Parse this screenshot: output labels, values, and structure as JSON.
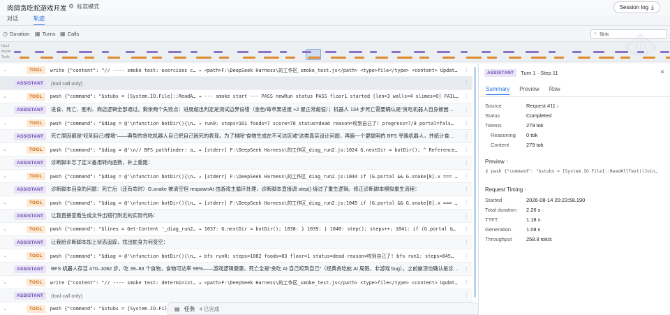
{
  "header": {
    "app_title": "肉鸽贪吃蛇游戏开发",
    "mode_label": "标准模式",
    "session_log_label": "Session log"
  },
  "tabs": [
    {
      "label": "对话",
      "active": false
    },
    {
      "label": "轨迹",
      "active": true
    }
  ],
  "toolbar": {
    "duration_label": "Duration",
    "turns_label": "Turns",
    "calls_label": "Calls",
    "search_placeholder": "搜索"
  },
  "timeline": {
    "row_labels": [
      "Input",
      "Model",
      "Tools"
    ]
  },
  "log_rows": [
    {
      "kind": "tool",
      "badge": "TOOL",
      "text": "write {\"content\": \"// ---- smoke test: exercises c… → <path>F:\\DeepSeek Harness\\的工作区_smoke_test.js</path> <type>file</type> <content> Update…"
    },
    {
      "kind": "assistant",
      "badge": "ASSISTANT",
      "text": "(tool call only)",
      "selected": true
    },
    {
      "kind": "tool",
      "badge": "TOOL",
      "text": "pwsh {\"command\": \"$stubs = [System.IO.File]::ReadA… → --- smoke start --- PASS newRun status PASS floor1 started [len=3 walls=4 slimes=0] FAIL…"
    },
    {
      "kind": "assistant",
      "badge": "ASSISTANT",
      "text": "进食、死亡、胜利、商店逻辑全部通过。剩余两个失败点：进度超出判定是测试边界设错（金色/毒苹果进度 +2 屋正常超值）；机器人 134 步死亡需要确认是\"贪吃机器人自身被困…"
    },
    {
      "kind": "tool",
      "badge": "TOOL",
      "text": "pwsh {\"command\": \"$diag = @'\\nfunction botDir(){\\n… → run0: steps=101 foods=7 score=70 status=dead reason=咬到自己了! progress=7/8 portal=fals…"
    },
    {
      "kind": "assistant",
      "badge": "ASSISTANT",
      "text": "死亡原因都是\"咬到自己/撞墙\"——典型的贪吃机器人自己把自己困死的表现。为了排除\"食物生成在不可达区域\"这类真实设计问题，再跑一个更聪明的 BFS 寻路机器人，并统计食…"
    },
    {
      "kind": "tool",
      "badge": "TOOL",
      "text": "pwsh {\"command\": \"$diag = @'\\n// BFS pathfinder: a… → [stderr] F:\\DeepSeek Harness\\的工作区_diag_run2.js:1024 G.nextDir = botDir(); ^ ReferenceE…"
    },
    {
      "kind": "assistant",
      "badge": "ASSISTANT",
      "text": "诊断脚本忘了定义备用转向函数，补上重跑："
    },
    {
      "kind": "tool",
      "badge": "TOOL",
      "text": "pwsh {\"command\": \"$diag = @'\\nfunction botDir(){\\n… → [stderr] F:\\DeepSeek Harness\\的工作区_diag_run2.js:1044 if (G.portal && G.snake[0].x === G…"
    },
    {
      "kind": "assistant",
      "badge": "ASSISTANT",
      "text": "诊断脚本自身的问题：死亡后（还有命时）G.snake 被清空但 respawnAt 由游戏主循环处理，诊断脚本直接调 step() 绕过了重生逻辑。修正诊断脚本模拟重生流程："
    },
    {
      "kind": "tool",
      "badge": "TOOL",
      "text": "pwsh {\"command\": \"$diag = @'\\nfunction botDir(){\\n… → [stderr] F:\\DeepSeek Harness\\的工作区_diag_run2.js:1045 if (G.portal && G.snake[0].x === G…"
    },
    {
      "kind": "assistant",
      "badge": "ASSISTANT",
      "text": "让我直接查看生成文件出错行附近的实际代码："
    },
    {
      "kind": "tool",
      "badge": "TOOL",
      "text": "pwsh {\"command\": \"$lines = Get-Content '_diag_run2… → 1037: G.nextDir = botDir(); 1038: } 1039: } 1040: step(); steps++; 1041: if (G.portal &…"
    },
    {
      "kind": "assistant",
      "badge": "ASSISTANT",
      "text": "让我给诊断脚本加上状态追踪，找出蛇身为何变空："
    },
    {
      "kind": "tool",
      "badge": "TOOL",
      "text": "pwsh {\"command\": \"$diag = @'\\nfunction botDir(){\\n… → bfs run0: steps=1082 foods=83 floor=1 status=dead reason=咬到自己了! bfs run1: steps=845…"
    },
    {
      "kind": "assistant",
      "badge": "ASSISTANT",
      "text": "BFS 机器人存活 470–1082 步，吃 39–83 个食物，食物可达率 99%——游戏逻辑健康，死亡全是\"贪吃 AI 自己咬到自己\"（经典贪吃蛇 AI 局限，非游戏 bug）。之前崩溃也确认是诊…"
    },
    {
      "kind": "tool",
      "badge": "TOOL",
      "text": "write {\"content\": \"// ---- smoke test: determinist… → <path>F:\\DeepSeek Harness\\的工作区_smoke_test.js</path> <type>file</type> <content> Update…"
    },
    {
      "kind": "assistant",
      "badge": "ASSISTANT",
      "text": "(tool call only)"
    },
    {
      "kind": "tool",
      "badge": "TOOL",
      "text": "pwsh {\"command\": \"$stubs = [System.IO.File]::ReadA…"
    }
  ],
  "panel": {
    "badge": "ASSISTANT",
    "turn_label": "Turn 1 · Step 11",
    "tabs": [
      {
        "label": "Summary",
        "active": true
      },
      {
        "label": "Preview",
        "active": false
      },
      {
        "label": "Raw",
        "active": false
      }
    ],
    "summary": [
      {
        "key": "Source",
        "value": "Request #11 ›"
      },
      {
        "key": "Status",
        "value": "Completed"
      },
      {
        "key": "Tokens",
        "value": "279 tok"
      },
      {
        "key": "Reasoning",
        "value": "0 tok",
        "sub": true
      },
      {
        "key": "Content",
        "value": "279 tok",
        "sub": true
      }
    ],
    "preview_title": "Preview",
    "preview_text": "pwsh {\"command\": \"$stubs = [System.IO.File]::ReadAllText((Join…",
    "timing_title": "Request Timing",
    "timing": [
      {
        "key": "Started",
        "value": "2026-08-14 20:23:58.190"
      },
      {
        "key": "Total duration",
        "value": "2.26 s"
      },
      {
        "key": "TTFT",
        "value": "1.18 s"
      },
      {
        "key": "Generation",
        "value": "1.08 s"
      },
      {
        "key": "Throughput",
        "value": "258.8 tok/s"
      }
    ]
  },
  "taskbar": {
    "label": "任务",
    "status": "4 已完成"
  },
  "colors": {
    "accent": "#1f6fe5",
    "tool_badge": "#c96a10",
    "assistant_badge": "#6a4bb2",
    "timeline_model": "#8b72c8",
    "timeline_tools": "#e08a2e"
  }
}
